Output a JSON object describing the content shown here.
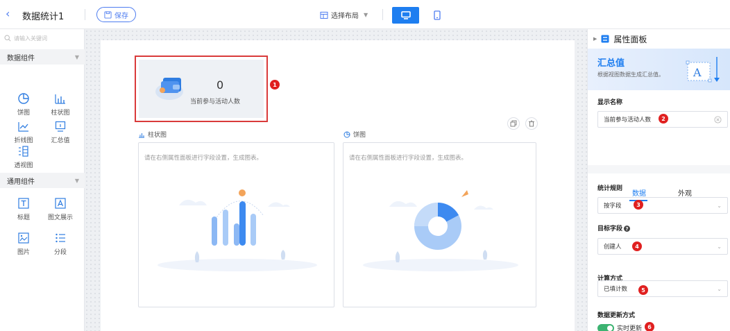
{
  "header": {
    "back_icon": "chevron-left-icon",
    "title": "数据统计1",
    "save_label": "保存",
    "layout_label": "选择布局"
  },
  "sidebar": {
    "search_placeholder": "请输入关键词",
    "groups": [
      {
        "label": "数据组件",
        "items": [
          {
            "label": "饼图",
            "icon": "pie-chart-icon"
          },
          {
            "label": "柱状图",
            "icon": "bar-chart-icon"
          },
          {
            "label": "折线图",
            "icon": "line-chart-icon"
          },
          {
            "label": "汇总值",
            "icon": "summary-value-icon"
          },
          {
            "label": "透视图",
            "icon": "pivot-table-icon"
          }
        ]
      },
      {
        "label": "通用组件",
        "items": [
          {
            "label": "标题",
            "icon": "title-text-icon"
          },
          {
            "label": "图文展示",
            "icon": "image-text-icon"
          },
          {
            "label": "图片",
            "icon": "image-icon"
          },
          {
            "label": "分段",
            "icon": "list-icon"
          }
        ]
      }
    ]
  },
  "canvas": {
    "stat_card": {
      "value": "0",
      "label": "当前参与活动人数",
      "badge": "1"
    },
    "bar_chart": {
      "title": "柱状图",
      "hint": "请在右侧属性面板进行字段设置，生成图表。"
    },
    "pie_chart": {
      "title": "饼图",
      "hint": "请在右侧属性面板进行字段设置，生成图表。"
    }
  },
  "panel": {
    "title": "属性面板",
    "banner_title": "汇总值",
    "banner_subtitle": "根据视图数据生成汇总值。",
    "display_name_label": "显示名称",
    "display_name_value": "当前参与活动人数",
    "display_name_badge": "2",
    "tabs": [
      "数据",
      "外观"
    ],
    "active_tab": "数据",
    "rule_label": "统计规则",
    "rule_value": "按字段",
    "rule_badge": "3",
    "field_label": "目标字段",
    "field_value": "创建人",
    "field_badge": "4",
    "calc_label": "计算方式",
    "calc_value": "已填计数",
    "calc_badge": "5",
    "update_label": "数据更新方式",
    "update_value": "实时更新",
    "update_badge": "6"
  },
  "colors": {
    "accent": "#1e7ef0",
    "highlight_border": "#d93a3a",
    "badge": "#e02020",
    "toggle_on": "#3cb371"
  }
}
